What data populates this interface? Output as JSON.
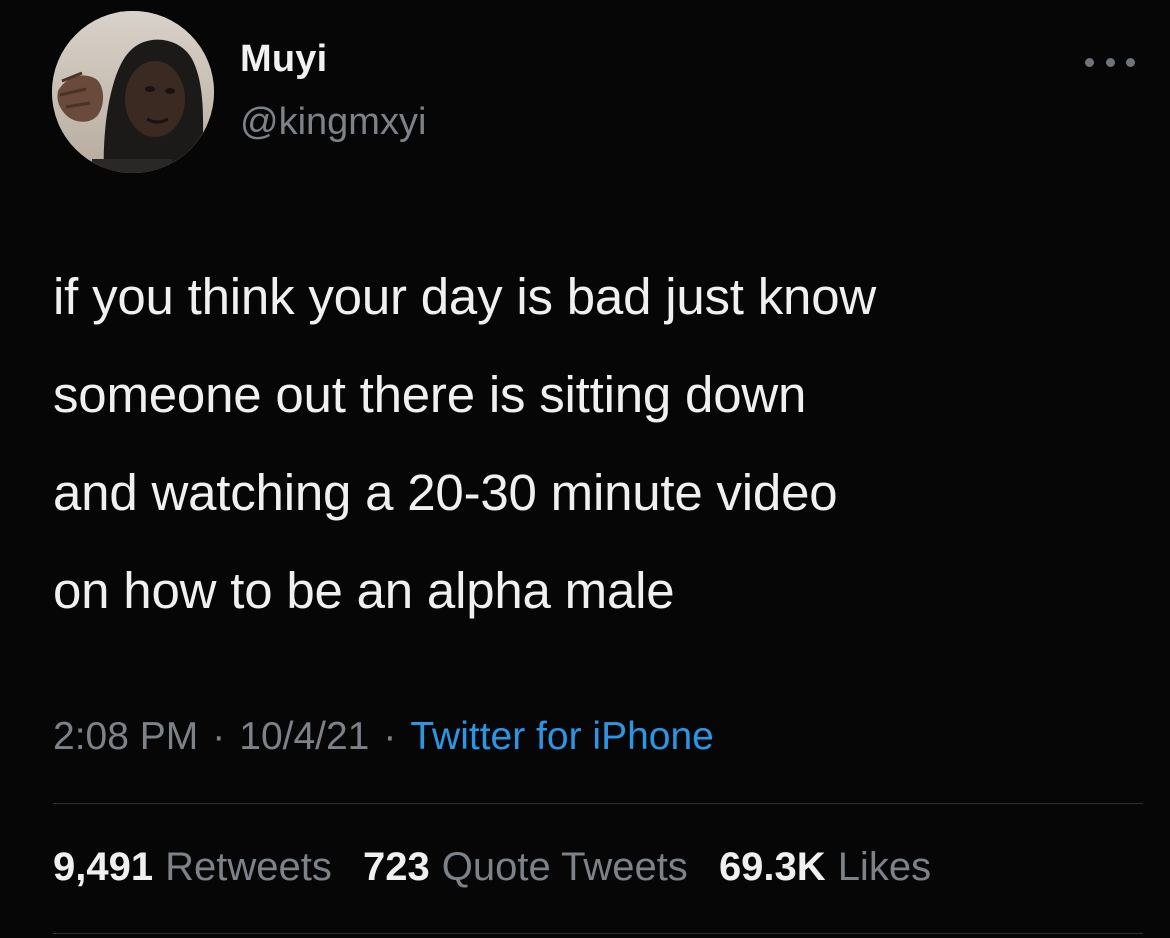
{
  "user": {
    "name": "Muyi",
    "handle": "@kingmxyi",
    "avatar_icon": "profile-photo"
  },
  "more_icon": "ellipsis-horizontal-icon",
  "tweet": {
    "text": "if you think your day is bad just know\nsomeone out there is sitting down\nand watching a 20-30 minute video\non how to be an alpha male"
  },
  "meta": {
    "time": "2:08 PM",
    "date": "10/4/21",
    "separator": "·",
    "source": "Twitter for iPhone"
  },
  "stats": {
    "retweets_count": "9,491",
    "retweets_label": "Retweets",
    "quotes_count": "723",
    "quotes_label": "Quote Tweets",
    "likes_count": "69.3K",
    "likes_label": "Likes"
  },
  "colors": {
    "background": "#060606",
    "text": "#f0f0f0",
    "muted": "#7c8288",
    "link": "#2a96e6",
    "divider": "#2c2f33"
  }
}
